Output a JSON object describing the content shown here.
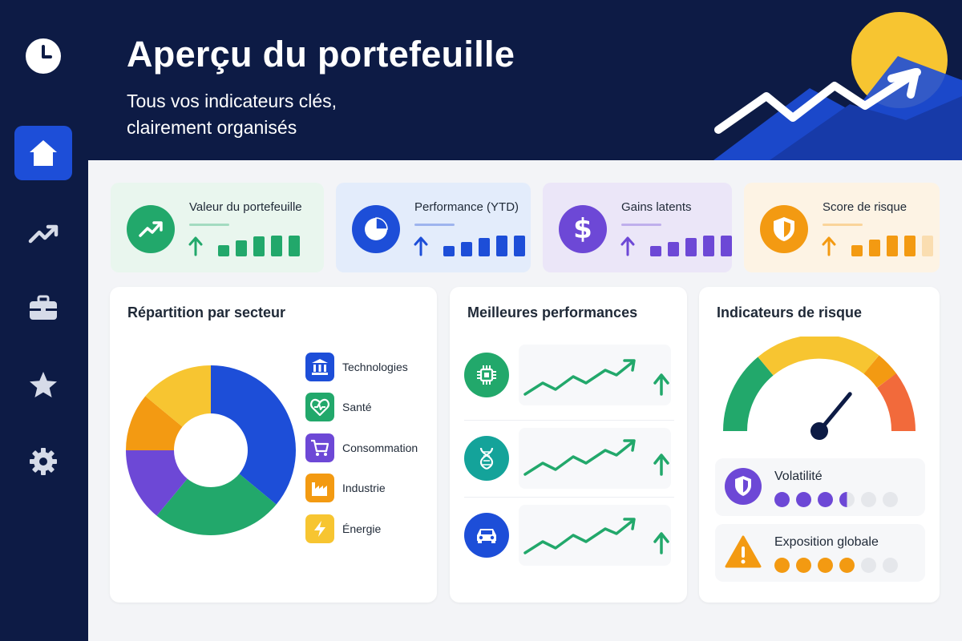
{
  "header": {
    "title": "Aperçu du portefeuille",
    "subtitle": "Tous vos indicateurs clés, clairement organisés"
  },
  "sidebar": {
    "items": [
      {
        "icon": "clock-icon",
        "active": false
      },
      {
        "icon": "home-icon",
        "active": true
      },
      {
        "icon": "trending-up-icon",
        "active": false
      },
      {
        "icon": "briefcase-icon",
        "active": false
      },
      {
        "icon": "star-icon",
        "active": false
      },
      {
        "icon": "gear-icon",
        "active": false
      }
    ]
  },
  "kpis": [
    {
      "label": "Valeur du portefeuille",
      "icon": "trend-up-icon",
      "color": "#22a86b",
      "bg": "#e9f6ee",
      "bars": [
        0.55,
        0.75,
        0.95,
        1.0,
        1.0
      ],
      "bars_active": 5
    },
    {
      "label": "Performance (YTD)",
      "icon": "pie-chart-icon",
      "color": "#1d4ed8",
      "bg": "#e3ecfb",
      "bars": [
        0.5,
        0.7,
        0.9,
        1.0,
        1.0
      ],
      "bars_active": 5
    },
    {
      "label": "Gains latents",
      "icon": "dollar-icon",
      "color": "#6d48d6",
      "bg": "#ebe6f8",
      "bars": [
        0.5,
        0.7,
        0.9,
        1.0,
        1.0
      ],
      "bars_active": 5
    },
    {
      "label": "Score de risque",
      "icon": "shield-icon",
      "color": "#f39a12",
      "bg": "#fdf3e4",
      "bars": [
        0.55,
        0.8,
        1.0,
        1.0,
        1.0
      ],
      "bars_active": 4
    }
  ],
  "sector_panel": {
    "title": "Répartition par secteur",
    "legend": [
      {
        "label": "Technologies",
        "icon": "bank-icon",
        "color": "#1d4ed8"
      },
      {
        "label": "Santé",
        "icon": "heart-pulse-icon",
        "color": "#22a86b"
      },
      {
        "label": "Consommation",
        "icon": "cart-icon",
        "color": "#6d48d6"
      },
      {
        "label": "Industrie",
        "icon": "factory-icon",
        "color": "#f39a12"
      },
      {
        "label": "Énergie",
        "icon": "bolt-icon",
        "color": "#f7c531"
      }
    ]
  },
  "chart_data": {
    "type": "pie",
    "categories": [
      "Technologies",
      "Santé",
      "Consommation",
      "Industrie",
      "Énergie"
    ],
    "values": [
      36,
      25,
      14,
      11,
      14
    ],
    "colors": [
      "#1d4ed8",
      "#22a86b",
      "#6d48d6",
      "#f39a12",
      "#f7c531"
    ],
    "title": "Répartition par secteur",
    "legend": "right"
  },
  "performers_panel": {
    "title": "Meilleures performances",
    "rows": [
      {
        "icon": "chip-icon",
        "color": "#22a86b"
      },
      {
        "icon": "dna-icon",
        "color": "#14a39a"
      },
      {
        "icon": "car-icon",
        "color": "#1d4ed8"
      }
    ]
  },
  "risk_panel": {
    "title": "Indicateurs de risque",
    "gauge_level": 0.72,
    "items": [
      {
        "label": "Volatilité",
        "icon": "shield-icon",
        "color": "#6d48d6",
        "level": 3.5,
        "max": 6
      },
      {
        "label": "Exposition globale",
        "icon": "warning-icon",
        "color": "#f39a12",
        "level": 4,
        "max": 6
      }
    ]
  }
}
